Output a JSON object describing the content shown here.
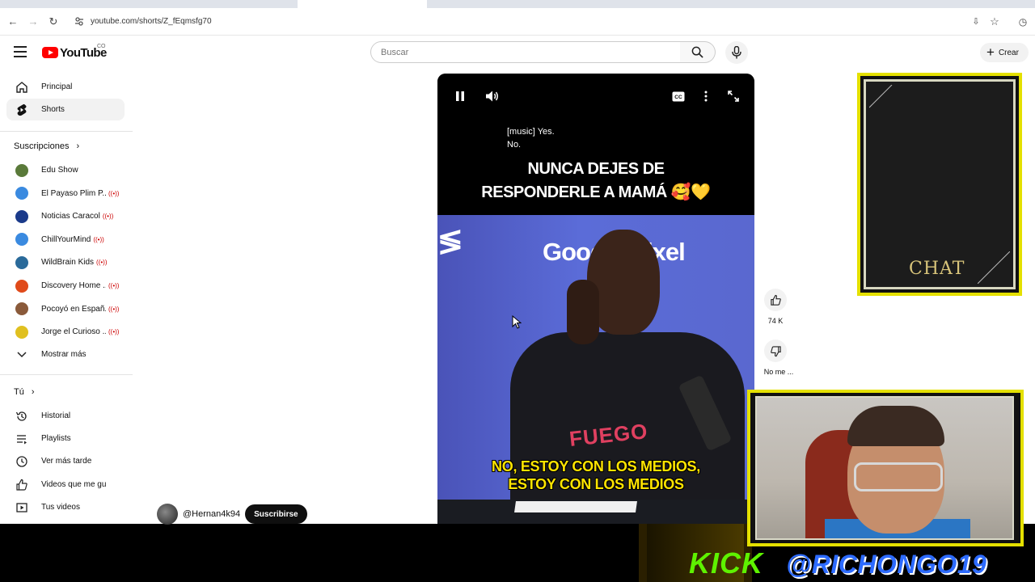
{
  "browser": {
    "url": "youtube.com/shorts/Z_fEqmsfg70",
    "tabs": [
      "...",
      "...",
      "...",
      "..."
    ]
  },
  "header": {
    "logo_text": "YouTube",
    "country": "CO",
    "search_placeholder": "Buscar",
    "create_label": "Crear"
  },
  "sidebar": {
    "main": [
      {
        "label": "Principal",
        "icon": "home-icon"
      },
      {
        "label": "Shorts",
        "icon": "shorts-icon",
        "active": true
      }
    ],
    "subscriptions_title": "Suscripciones",
    "subscriptions": [
      {
        "label": "Edu Show",
        "color": "#5a7a3a",
        "live": false
      },
      {
        "label": "El Payaso Plim P...",
        "color": "#3a8ae0",
        "live": true
      },
      {
        "label": "Noticias Caracol",
        "color": "#1a3a8a",
        "live": true
      },
      {
        "label": "ChillYourMind",
        "color": "#3a8ae0",
        "live": true
      },
      {
        "label": "WildBrain Kids",
        "color": "#2a6a9a",
        "live": true
      },
      {
        "label": "Discovery Home ...",
        "color": "#e04a1a",
        "live": true
      },
      {
        "label": "Pocoyó en Españ...",
        "color": "#8a5a3a",
        "live": true
      },
      {
        "label": "Jorge el Curioso ...",
        "color": "#e0c020",
        "live": true
      }
    ],
    "show_more": "Mostrar más",
    "you_title": "Tú",
    "you_items": [
      {
        "label": "Historial",
        "icon": "history-icon"
      },
      {
        "label": "Playlists",
        "icon": "playlists-icon"
      },
      {
        "label": "Ver más tarde",
        "icon": "watch-later-icon"
      },
      {
        "label": "Videos que me gus...",
        "icon": "liked-icon"
      },
      {
        "label": "Tus videos",
        "icon": "your-videos-icon"
      }
    ]
  },
  "video": {
    "captions_line1": "[music] Yes.",
    "captions_line2": "No.",
    "headline_line1": "NUNCA DEJES DE",
    "headline_line2": "RESPONDERLE A MAMÁ 🥰💛",
    "scene_brand": "Google Pixel",
    "subtitle_line1": "NO, ESTOY CON LOS MEDIOS,",
    "subtitle_line2": "ESTOY CON LOS MEDIOS",
    "shirt_text": "FUEGO"
  },
  "channel": {
    "name": "@Hernan4k94",
    "subscribe_label": "Suscribirse"
  },
  "actions": {
    "like_count": "74 K",
    "dislike_label": "No me ..."
  },
  "overlay": {
    "chat_label": "CHAT",
    "kick_label": "KICK",
    "kick_handle": "@RICHONGO19"
  }
}
